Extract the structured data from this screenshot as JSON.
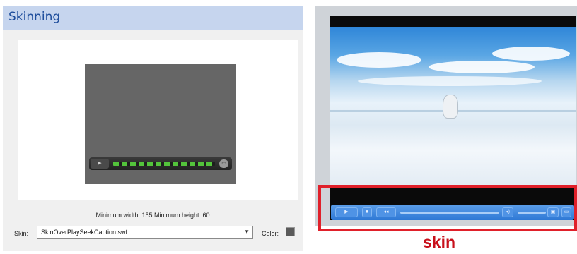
{
  "panel": {
    "title": "Skinning",
    "min_dimensions": "Minimum width: 155   Minimum height: 60",
    "skin_label": "Skin:",
    "skin_value": "SkinOverPlaySeekCaption.swf",
    "color_label": "Color:"
  },
  "preview": {
    "play_glyph": "▶",
    "caption_glyph": "▭",
    "seek_color": "#53c33b"
  },
  "player": {
    "play_glyph": "▶",
    "stop_glyph": "■",
    "rewind_glyph": "◂◂",
    "mute_glyph": "◂)",
    "fullscreen_glyph": "▣",
    "caption_glyph": "▭",
    "skin_accent": "#2e78d5"
  },
  "annotation": {
    "label": "skin",
    "color": "#e0202a"
  }
}
